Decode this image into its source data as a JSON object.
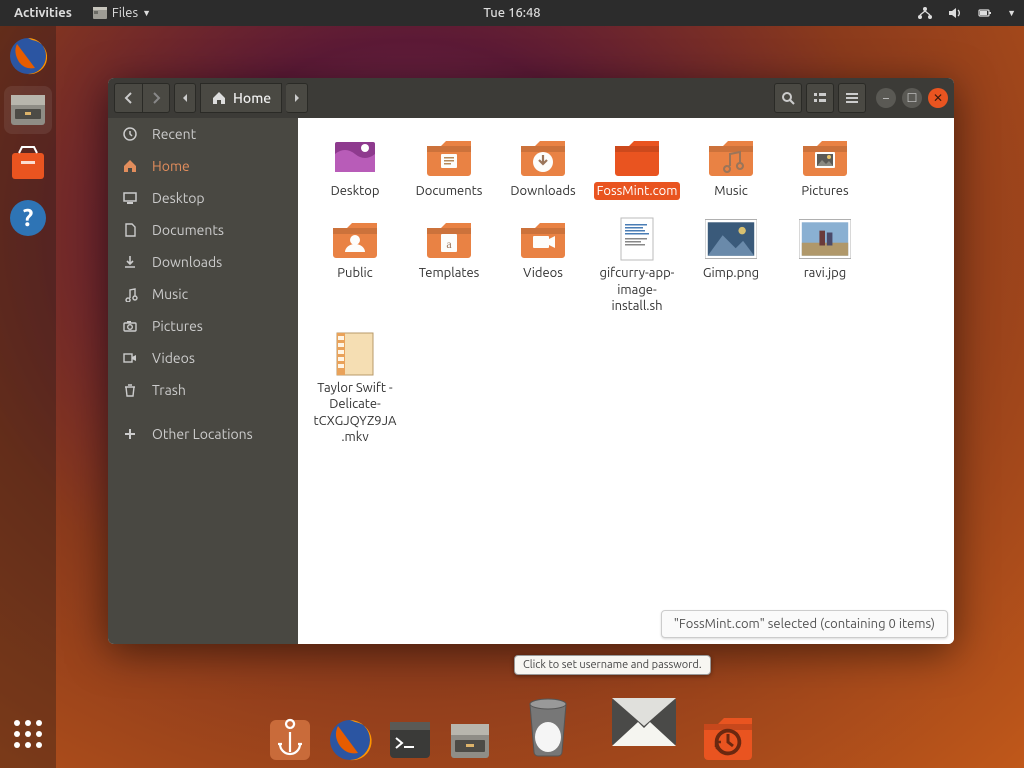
{
  "topbar": {
    "activities": "Activities",
    "files_menu": "Files",
    "clock": "Tue 16:48"
  },
  "titlebar": {
    "path_label": "Home"
  },
  "sidebar": {
    "items": [
      {
        "icon": "clock",
        "label": "Recent"
      },
      {
        "icon": "home",
        "label": "Home",
        "active": true
      },
      {
        "icon": "desktop",
        "label": "Desktop"
      },
      {
        "icon": "document",
        "label": "Documents"
      },
      {
        "icon": "download",
        "label": "Downloads"
      },
      {
        "icon": "music",
        "label": "Music"
      },
      {
        "icon": "camera",
        "label": "Pictures"
      },
      {
        "icon": "video",
        "label": "Videos"
      },
      {
        "icon": "trash",
        "label": "Trash"
      }
    ],
    "other_label": "Other Locations"
  },
  "files": [
    {
      "name": "Desktop",
      "type": "folder-desktop"
    },
    {
      "name": "Documents",
      "type": "folder"
    },
    {
      "name": "Downloads",
      "type": "folder-download"
    },
    {
      "name": "FossMint.com",
      "type": "folder-selected",
      "selected": true
    },
    {
      "name": "Music",
      "type": "folder-music"
    },
    {
      "name": "Pictures",
      "type": "folder-pictures"
    },
    {
      "name": "Public",
      "type": "folder-public"
    },
    {
      "name": "Templates",
      "type": "folder-templates"
    },
    {
      "name": "Videos",
      "type": "folder-videos"
    },
    {
      "name": "gifcurry-app-image-install.sh",
      "type": "text"
    },
    {
      "name": "Gimp.png",
      "type": "image"
    },
    {
      "name": "ravi.jpg",
      "type": "image2"
    },
    {
      "name": "Taylor Swift - Delicate-tCXGJQYZ9JA.mkv",
      "type": "video-file"
    }
  ],
  "status": "\"FossMint.com\" selected  (containing 0 items)",
  "tooltip": "Click to set username and password."
}
